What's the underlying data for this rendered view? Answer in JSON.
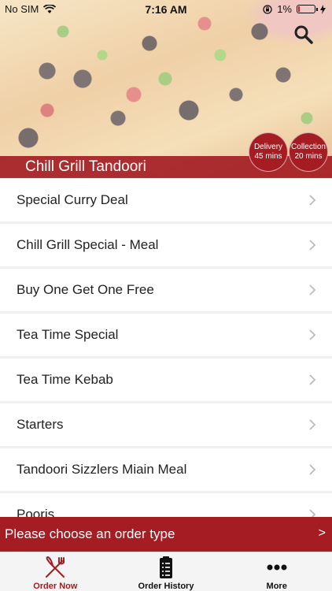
{
  "status_bar": {
    "carrier": "No SIM",
    "time": "7:16 AM",
    "battery": "1%"
  },
  "header": {
    "restaurant_name": "Chill Grill Tandoori",
    "delivery": {
      "label": "Delivery",
      "time": "45 mins"
    },
    "collection": {
      "label": "Collection",
      "time": "20 mins"
    }
  },
  "menu": {
    "items": [
      {
        "label": "Special Curry Deal"
      },
      {
        "label": "Chill Grill Special - Meal"
      },
      {
        "label": "Buy One Get One Free"
      },
      {
        "label": "Tea Time Special"
      },
      {
        "label": "Tea Time Kebab"
      },
      {
        "label": "Starters"
      },
      {
        "label": "Tandoori Sizzlers Miain Meal"
      },
      {
        "label": "Pooris"
      }
    ]
  },
  "order_bar": {
    "text": "Please choose an order type",
    "arrow": ">"
  },
  "tabs": [
    {
      "label": "Order Now",
      "icon": "fork-knife-icon",
      "active": true
    },
    {
      "label": "Order History",
      "icon": "clipboard-icon",
      "active": false
    },
    {
      "label": "More",
      "icon": "more-dots-icon",
      "active": false
    }
  ],
  "colors": {
    "accent": "#a51c22"
  }
}
